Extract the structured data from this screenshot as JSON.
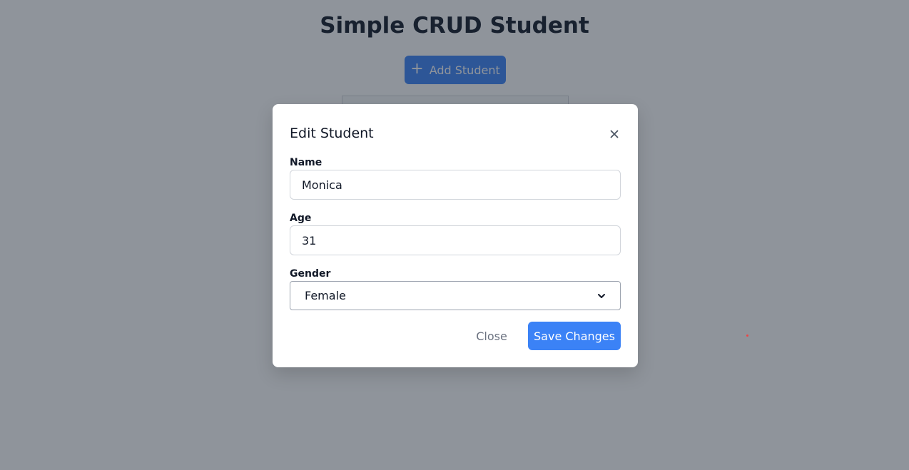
{
  "page": {
    "title": "Simple CRUD Student",
    "add_button_label": "Add Student"
  },
  "modal": {
    "title": "Edit Student",
    "close_icon": "close-icon",
    "fields": {
      "name": {
        "label": "Name",
        "value": "Monica"
      },
      "age": {
        "label": "Age",
        "value": "31"
      },
      "gender": {
        "label": "Gender",
        "selected": "Female"
      }
    },
    "buttons": {
      "close_label": "Close",
      "save_label": "Save Changes"
    }
  },
  "colors": {
    "primary": "#3b82f6",
    "overlay": "rgba(31,41,55,0.5)",
    "text": "#111827"
  }
}
